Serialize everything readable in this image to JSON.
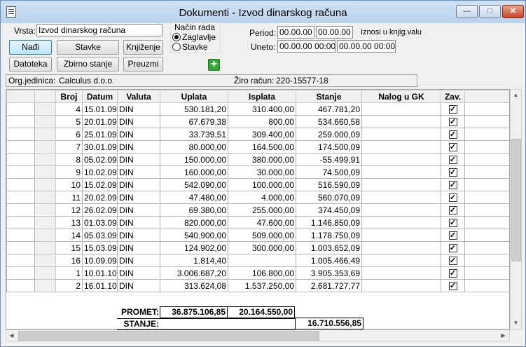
{
  "window": {
    "title": "Dokumenti - Izvod dinarskog računa",
    "minimize": "—",
    "maximize": "□",
    "close": "✕"
  },
  "form": {
    "vrsta_label": "Vrsta:",
    "vrsta_value": "Izvod dinarskog računa",
    "nacin_rada_label": "Način rada",
    "radio_zaglavlje": "Zaglavlje",
    "radio_stavke": "Stavke",
    "period_label": "Period:",
    "period_from": "00.00.00",
    "period_to": "00.00.00",
    "iznosi_label": "Iznosi u knjig.valu",
    "uneto_label": "Uneto:",
    "uneto_from": "00.00.00 00:00",
    "uneto_to": "00.00.00 00:00",
    "org_label": "Org.jedinica:",
    "org_value": "Calculus d.o.o.",
    "ziro_label": "Žiro račun:",
    "ziro_value": "220-15577-18"
  },
  "buttons": {
    "nadji": "Nađi",
    "stavke": "Stavke",
    "knjizenje": "Knjiženje",
    "datoteka": "Datoteka",
    "zbirno": "Zbirno stanje",
    "preuzmi": "Preuzmi",
    "add": "+"
  },
  "table": {
    "columns": [
      "Broj",
      "Datum",
      "Valuta",
      "Uplata",
      "Isplata",
      "Stanje",
      "Nalog u GK",
      "Zav."
    ],
    "rows": [
      {
        "broj": "4",
        "datum": "15.01.09",
        "valuta": "DIN",
        "uplata": "530.181,20",
        "isplata": "310.400,00",
        "stanje": "467.781,20",
        "nalog": "",
        "zav": "✓"
      },
      {
        "broj": "5",
        "datum": "20.01.09",
        "valuta": "DIN",
        "uplata": "67.679,38",
        "isplata": "800,00",
        "stanje": "534.660,58",
        "nalog": "",
        "zav": "✓"
      },
      {
        "broj": "6",
        "datum": "25.01.09",
        "valuta": "DIN",
        "uplata": "33.739,51",
        "isplata": "309.400,00",
        "stanje": "259.000,09",
        "nalog": "",
        "zav": "✓"
      },
      {
        "broj": "7",
        "datum": "30.01.09",
        "valuta": "DIN",
        "uplata": "80.000,00",
        "isplata": "164.500,00",
        "stanje": "174.500,09",
        "nalog": "",
        "zav": "✓"
      },
      {
        "broj": "8",
        "datum": "05.02.09",
        "valuta": "DIN",
        "uplata": "150.000,00",
        "isplata": "380.000,00",
        "stanje": "-55.499,91",
        "nalog": "",
        "zav": "✓"
      },
      {
        "broj": "9",
        "datum": "10.02.09",
        "valuta": "DIN",
        "uplata": "160.000,00",
        "isplata": "30.000,00",
        "stanje": "74.500,09",
        "nalog": "",
        "zav": "✓"
      },
      {
        "broj": "10",
        "datum": "15.02.09",
        "valuta": "DIN",
        "uplata": "542.090,00",
        "isplata": "100.000,00",
        "stanje": "516.590,09",
        "nalog": "",
        "zav": "✓"
      },
      {
        "broj": "11",
        "datum": "20.02.09",
        "valuta": "DIN",
        "uplata": "47.480,00",
        "isplata": "4.000,00",
        "stanje": "560.070,09",
        "nalog": "",
        "zav": "✓"
      },
      {
        "broj": "12",
        "datum": "26.02.09",
        "valuta": "DIN",
        "uplata": "69.380,00",
        "isplata": "255.000,00",
        "stanje": "374.450,09",
        "nalog": "",
        "zav": "✓"
      },
      {
        "broj": "13",
        "datum": "01.03.09",
        "valuta": "DIN",
        "uplata": "820.000,00",
        "isplata": "47.600,00",
        "stanje": "1.146.850,09",
        "nalog": "",
        "zav": "✓"
      },
      {
        "broj": "14",
        "datum": "05.03.09",
        "valuta": "DIN",
        "uplata": "540.900,00",
        "isplata": "509.000,00",
        "stanje": "1.178.750,09",
        "nalog": "",
        "zav": "✓"
      },
      {
        "broj": "15",
        "datum": "15.03.09",
        "valuta": "DIN",
        "uplata": "124.902,00",
        "isplata": "300.000,00",
        "stanje": "1.003.652,09",
        "nalog": "",
        "zav": "✓"
      },
      {
        "broj": "16",
        "datum": "10.09.09",
        "valuta": "DIN",
        "uplata": "1.814,40",
        "isplata": "",
        "stanje": "1.005.466,49",
        "nalog": "",
        "zav": "✓"
      },
      {
        "broj": "1",
        "datum": "10.01.10",
        "valuta": "DIN",
        "uplata": "3.006.687,20",
        "isplata": "106.800,00",
        "stanje": "3.905.353,69",
        "nalog": "",
        "zav": "✓"
      },
      {
        "broj": "2",
        "datum": "16.01.10",
        "valuta": "DIN",
        "uplata": "313.624,08",
        "isplata": "1.537.250,00",
        "stanje": "2.681.727,77",
        "nalog": "",
        "zav": "✓"
      }
    ]
  },
  "totals": {
    "promet_label": "PROMET:",
    "promet_uplata": "36.875.106,85",
    "promet_isplata": "20.164.550,00",
    "stanje_label": "STANJE:",
    "stanje_value": "16.710.556,85"
  }
}
